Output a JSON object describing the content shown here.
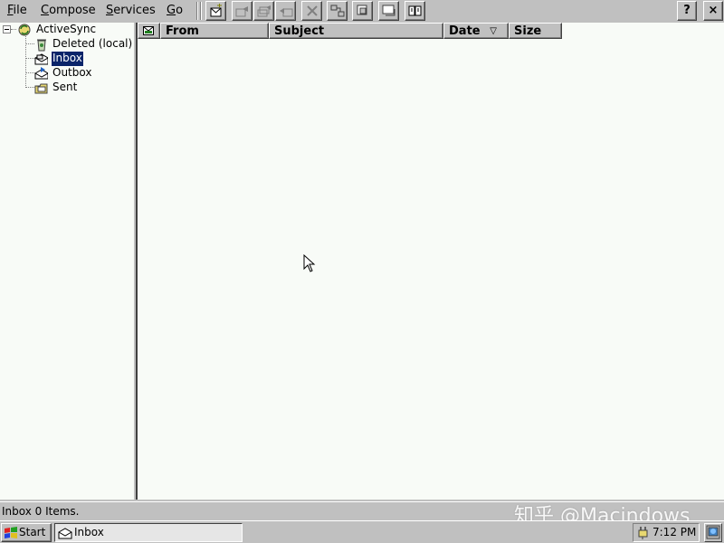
{
  "menu": {
    "file": {
      "first": "F",
      "rest": "ile"
    },
    "compose": {
      "first": "C",
      "rest": "ompose"
    },
    "services": {
      "first": "S",
      "rest": "ervices"
    },
    "go": {
      "first": "G",
      "rest": "o"
    }
  },
  "toolbar": {
    "buttons": [
      "new-message-icon",
      "reply-icon",
      "reply-all-icon",
      "forward-icon",
      "delete-icon",
      "connect-icon",
      "disconnect-icon",
      "send-receive-icon",
      "address-book-icon"
    ],
    "help_label": "?",
    "close_label": "×"
  },
  "tree": {
    "root": {
      "label": "ActiveSync",
      "icon": "activesync-icon"
    },
    "folders": [
      {
        "label": "Deleted (local)",
        "icon": "deleted-folder-icon",
        "selected": false
      },
      {
        "label": "Inbox",
        "icon": "inbox-icon",
        "selected": true
      },
      {
        "label": "Outbox",
        "icon": "outbox-icon",
        "selected": false
      },
      {
        "label": "Sent",
        "icon": "sent-folder-icon",
        "selected": false
      }
    ]
  },
  "list": {
    "columns": {
      "icon": "envelope-icon",
      "from": "From",
      "subject": "Subject",
      "date": "Date",
      "date_sort": "▽",
      "size": "Size"
    },
    "rows": []
  },
  "status": {
    "text": "Inbox 0 Items."
  },
  "watermark": "知乎 @Macindows",
  "taskbar": {
    "start_label": "Start",
    "task_label": "Inbox",
    "clock": "7:12 PM"
  },
  "colors": {
    "selection": "#0a246a",
    "window_bg": "#f8fbf7",
    "chrome": "#c0c0c0"
  }
}
